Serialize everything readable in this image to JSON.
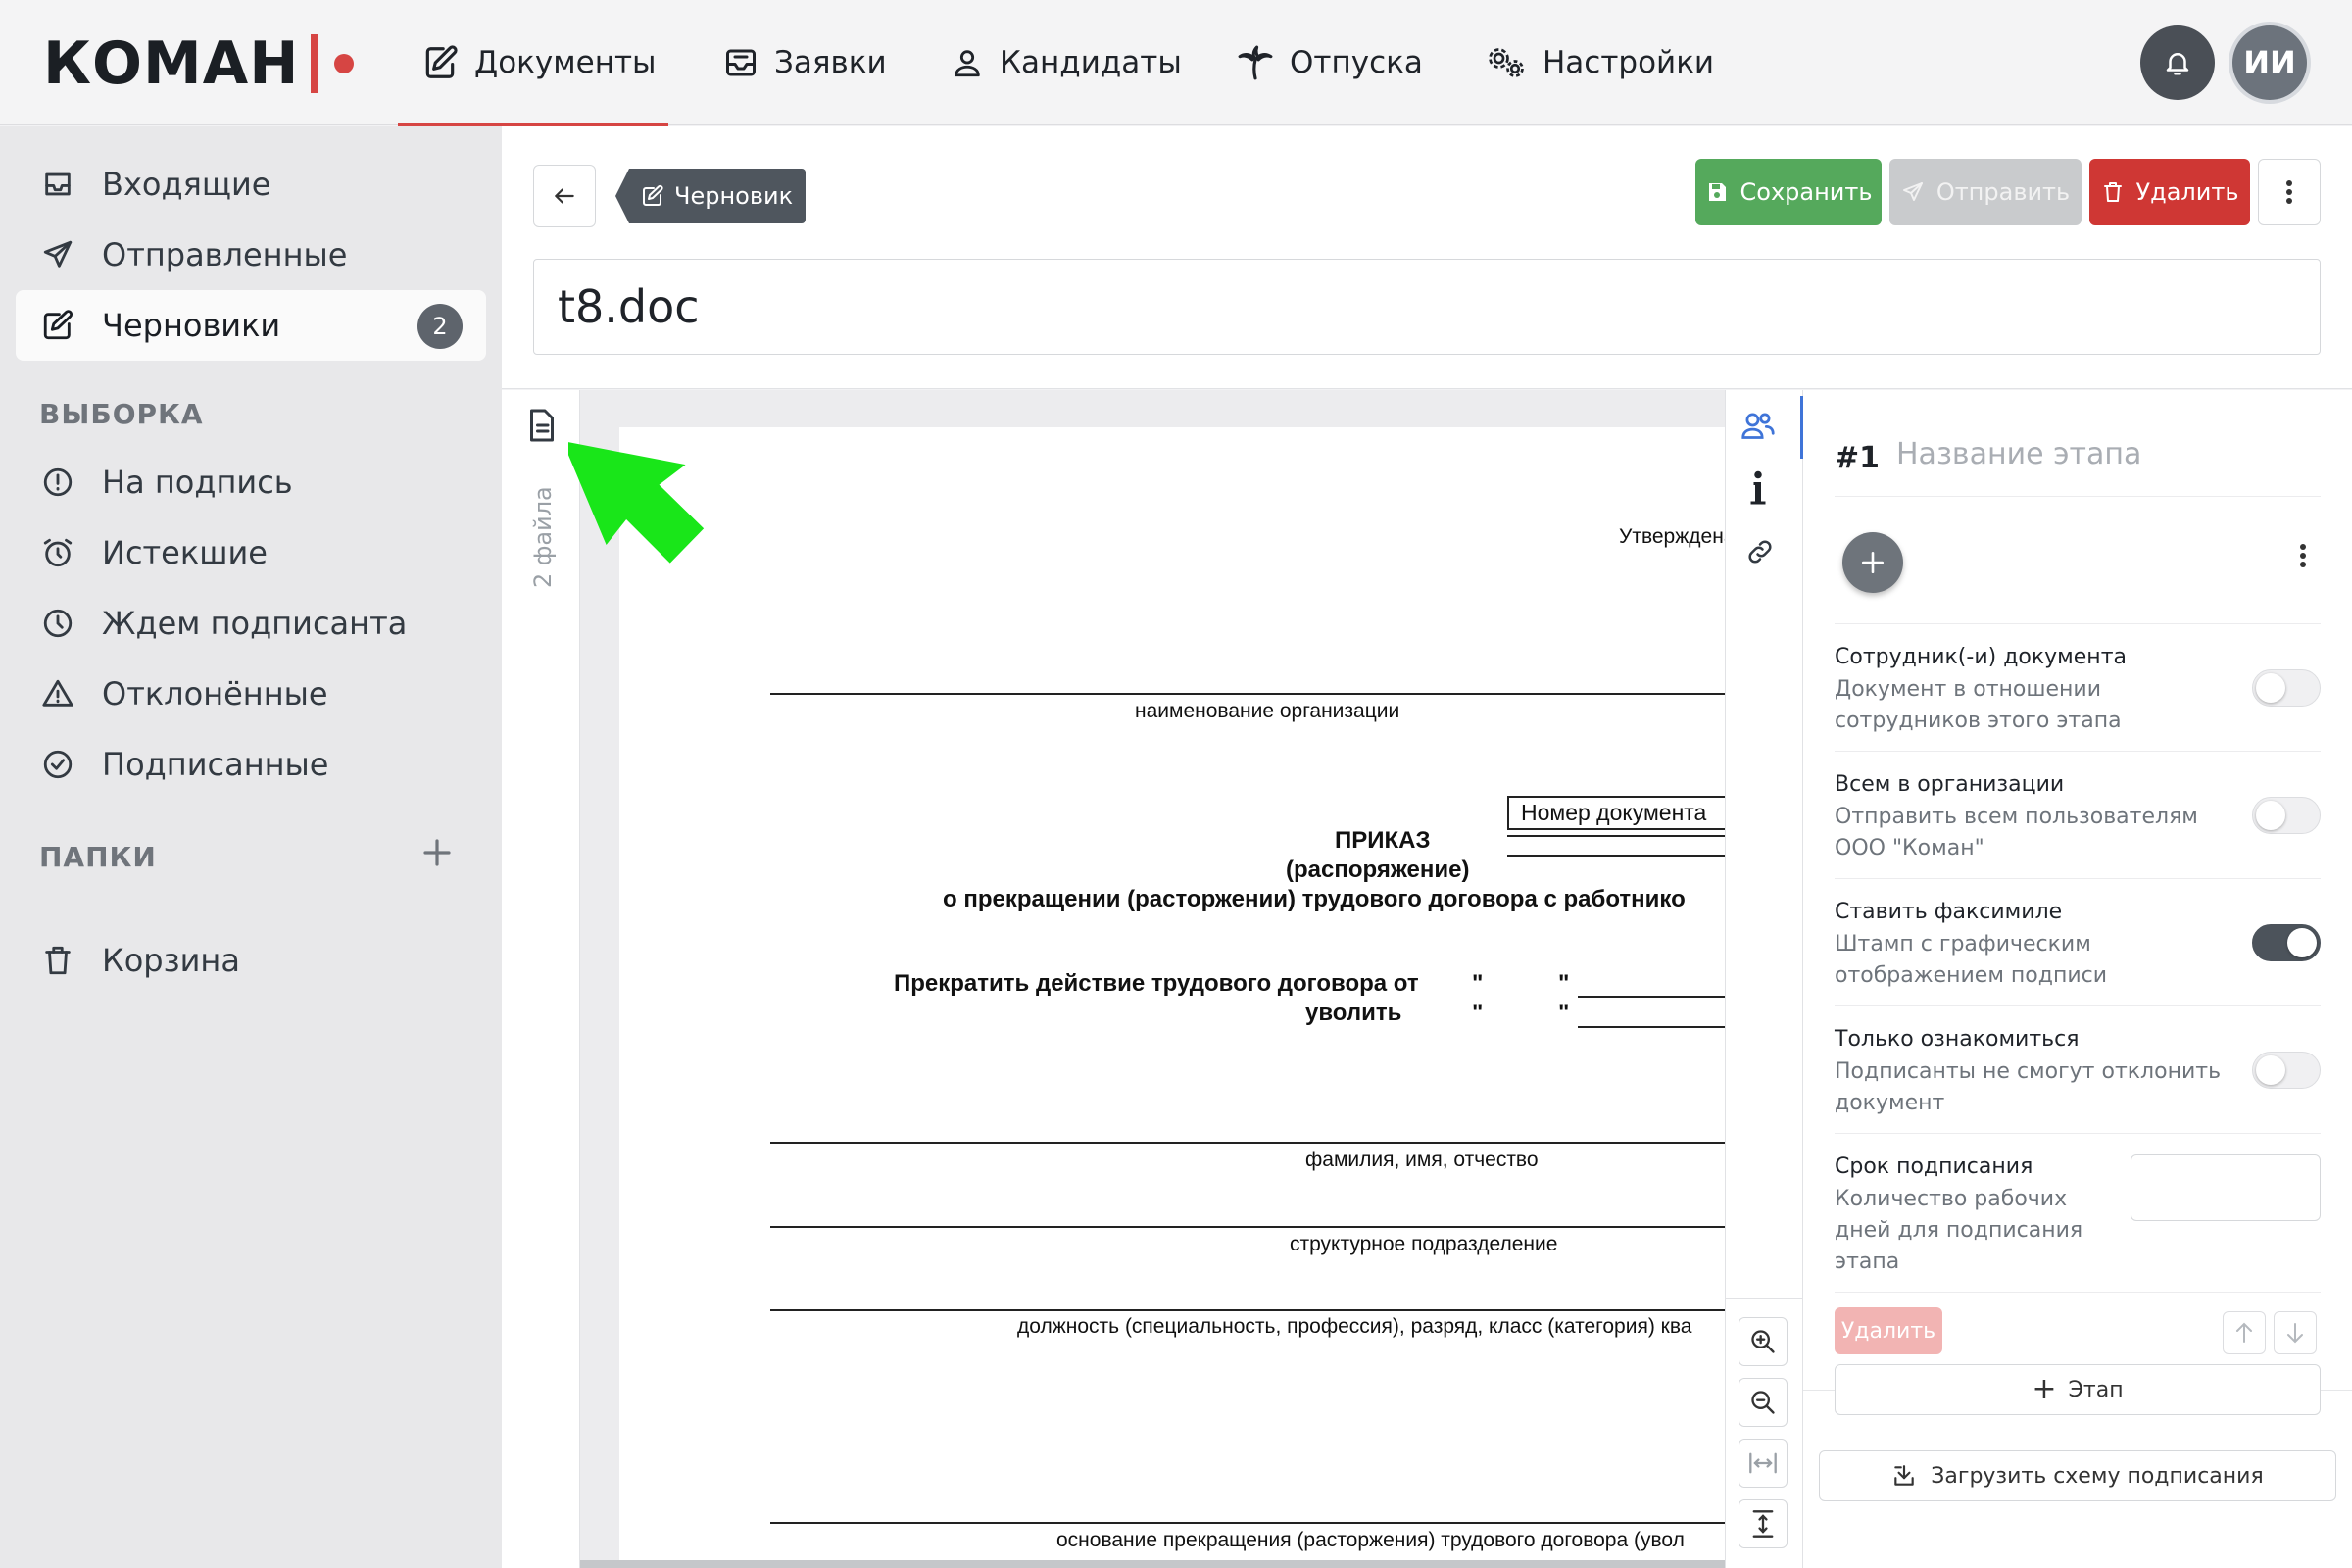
{
  "brand": {
    "name": "КОМАН"
  },
  "nav": {
    "items": [
      {
        "label": "Документы",
        "icon": "document-edit-icon",
        "active": true
      },
      {
        "label": "Заявки",
        "icon": "inbox-tray-icon"
      },
      {
        "label": "Кандидаты",
        "icon": "user-search-icon"
      },
      {
        "label": "Отпуска",
        "icon": "palm-tree-icon"
      },
      {
        "label": "Настройки",
        "icon": "gears-icon"
      }
    ],
    "avatar_initials": "ИИ"
  },
  "sidebar": {
    "items": [
      {
        "label": "Входящие",
        "icon": "inbox-icon"
      },
      {
        "label": "Отправленные",
        "icon": "paper-plane-icon"
      },
      {
        "label": "Черновики",
        "icon": "edit-icon",
        "active": true,
        "badge": "2"
      }
    ],
    "selection_heading": "ВЫБОРКА",
    "selection": [
      {
        "label": "На подпись",
        "icon": "alert-circle-icon"
      },
      {
        "label": "Истекшие",
        "icon": "alarm-clock-icon"
      },
      {
        "label": "Ждем подписанта",
        "icon": "clock-icon"
      },
      {
        "label": "Отклонённые",
        "icon": "warning-triangle-icon"
      },
      {
        "label": "Подписанные",
        "icon": "check-circle-icon"
      }
    ],
    "folders_heading": "ПАПКИ",
    "trash_label": "Корзина"
  },
  "toolbar": {
    "status_tag": "Черновик",
    "save_label": "Сохранить",
    "send_label": "Отправить",
    "delete_label": "Удалить"
  },
  "document": {
    "title": "t8.doc",
    "file_count": "2 файла",
    "preview": {
      "approved": "Утверждена по",
      "org_caption": "наименование организации",
      "doc_number": "Номер документа",
      "order": "ПРИКАЗ",
      "order_sub": "(распоряжение)",
      "order_subject": "о прекращении (расторжении) трудового договора с работнико",
      "terminate_from": "Прекратить действие трудового договора от",
      "dismiss": "уволить",
      "quote": "\"",
      "fio_caption": "фамилия, имя, отчество",
      "unit_caption": "структурное подразделение",
      "position_caption": "должность (специальность, профессия), разряд, класс (категория) ква",
      "basis_caption": "основание прекращения (расторжения) трудового договора (увол"
    }
  },
  "stage": {
    "number": "#1",
    "name_placeholder": "Название этапа",
    "options": [
      {
        "title": "Сотрудник(-и) документа",
        "desc": "Документ в отношении сотрудников этого этапа",
        "on": false
      },
      {
        "title": "Всем в организации",
        "desc": "Отправить всем пользователям ООО \"Коман\"",
        "on": false
      },
      {
        "title": "Ставить факсимиле",
        "desc": "Штамп с графическим отображением подписи",
        "on": true
      },
      {
        "title": "Только ознакомиться",
        "desc": "Подписанты не смогут отклонить документ",
        "on": false
      }
    ],
    "deadline_title": "Срок подписания",
    "deadline_desc": "Количество рабочих дней для подписания этапа",
    "deadline_value": "",
    "delete_label": "Удалить",
    "add_stage_label": "Этап",
    "load_scheme_label": "Загрузить схему подписания"
  },
  "colors": {
    "accent": "#d64543",
    "save": "#55a95c",
    "delete": "#cf3734",
    "arrow": "#19e619",
    "active_tab": "#3f74d8"
  }
}
